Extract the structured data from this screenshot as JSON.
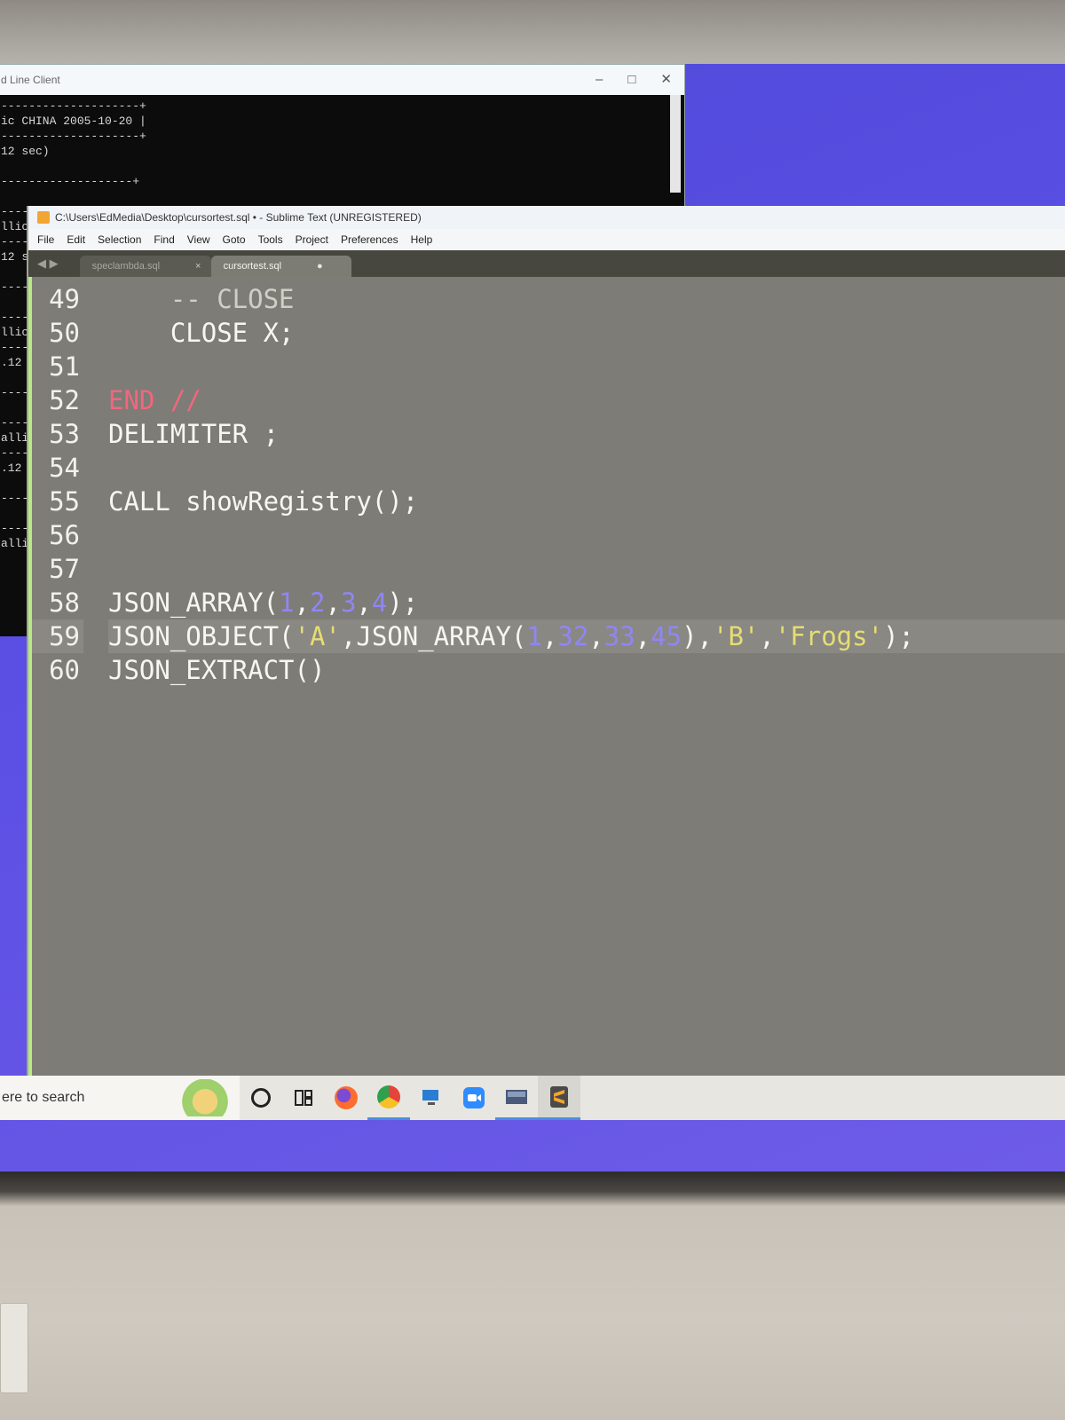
{
  "cmd_window": {
    "title": "d Line Client",
    "controls": [
      "–",
      "□",
      "✕"
    ],
    "lines": [
      "--------------------+",
      "ic CHINA 2005-10-20 |",
      "--------------------+",
      "12 sec)",
      "",
      "-------------------+",
      "",
      "-----",
      "llic",
      "-----",
      "12 s",
      "",
      "-----",
      "",
      "-----",
      "llic",
      "-----",
      ".12 s",
      "",
      "-----",
      "",
      "-----",
      "allic",
      "-----",
      ".12 s",
      "",
      "-----",
      "",
      "-----",
      "allic"
    ]
  },
  "sublime": {
    "title": "C:\\Users\\EdMedia\\Desktop\\cursortest.sql • - Sublime Text (UNREGISTERED)",
    "menu": [
      "File",
      "Edit",
      "Selection",
      "Find",
      "View",
      "Goto",
      "Tools",
      "Project",
      "Preferences",
      "Help"
    ],
    "tab_nav": "◀ ▶",
    "tabs": [
      {
        "label": "speclambda.sql",
        "marker": "×",
        "active": false
      },
      {
        "label": "cursortest.sql",
        "marker": "●",
        "active": true
      }
    ],
    "line_numbers": [
      "49",
      "50",
      "51",
      "52",
      "53",
      "54",
      "55",
      "56",
      "57",
      "58",
      "59",
      "60"
    ],
    "code": {
      "l49": "    -- CLOSE",
      "l50": "    CLOSE X;",
      "l52": "END //",
      "l53": "DELIMITER ;",
      "l55": "CALL showRegistry();",
      "l58_a": "JSON_ARRAY(",
      "l58_n1": "1",
      "l58_n2": "2",
      "l58_n3": "3",
      "l58_n4": "4",
      "l58_b": ");",
      "l59_a": "JSON_OBJECT(",
      "l59_s1": "'A'",
      "l59_b": ",JSON_ARRAY(",
      "l59_n1": "1",
      "l59_n2": "32",
      "l59_n3": "33",
      "l59_n4": "45",
      "l59_c": "),",
      "l59_s2": "'B'",
      "l59_s3": "'Frogs'",
      "l59_d": ");",
      "l60": "JSON_EXTRACT()"
    }
  },
  "taskbar": {
    "search_placeholder": "ere to search",
    "icons": [
      "cortana-circle",
      "task-view",
      "firefox",
      "chrome",
      "remote-desktop",
      "zoom",
      "mysql-workbench",
      "sublime-text"
    ]
  },
  "colors": {
    "desktop": "#5a4ee3",
    "editor_bg": "#7e7c76",
    "number": "#8f86f5",
    "string": "#e6dd74",
    "keyword_end": "#f2667f",
    "gutter_mark": "#b8e986"
  }
}
